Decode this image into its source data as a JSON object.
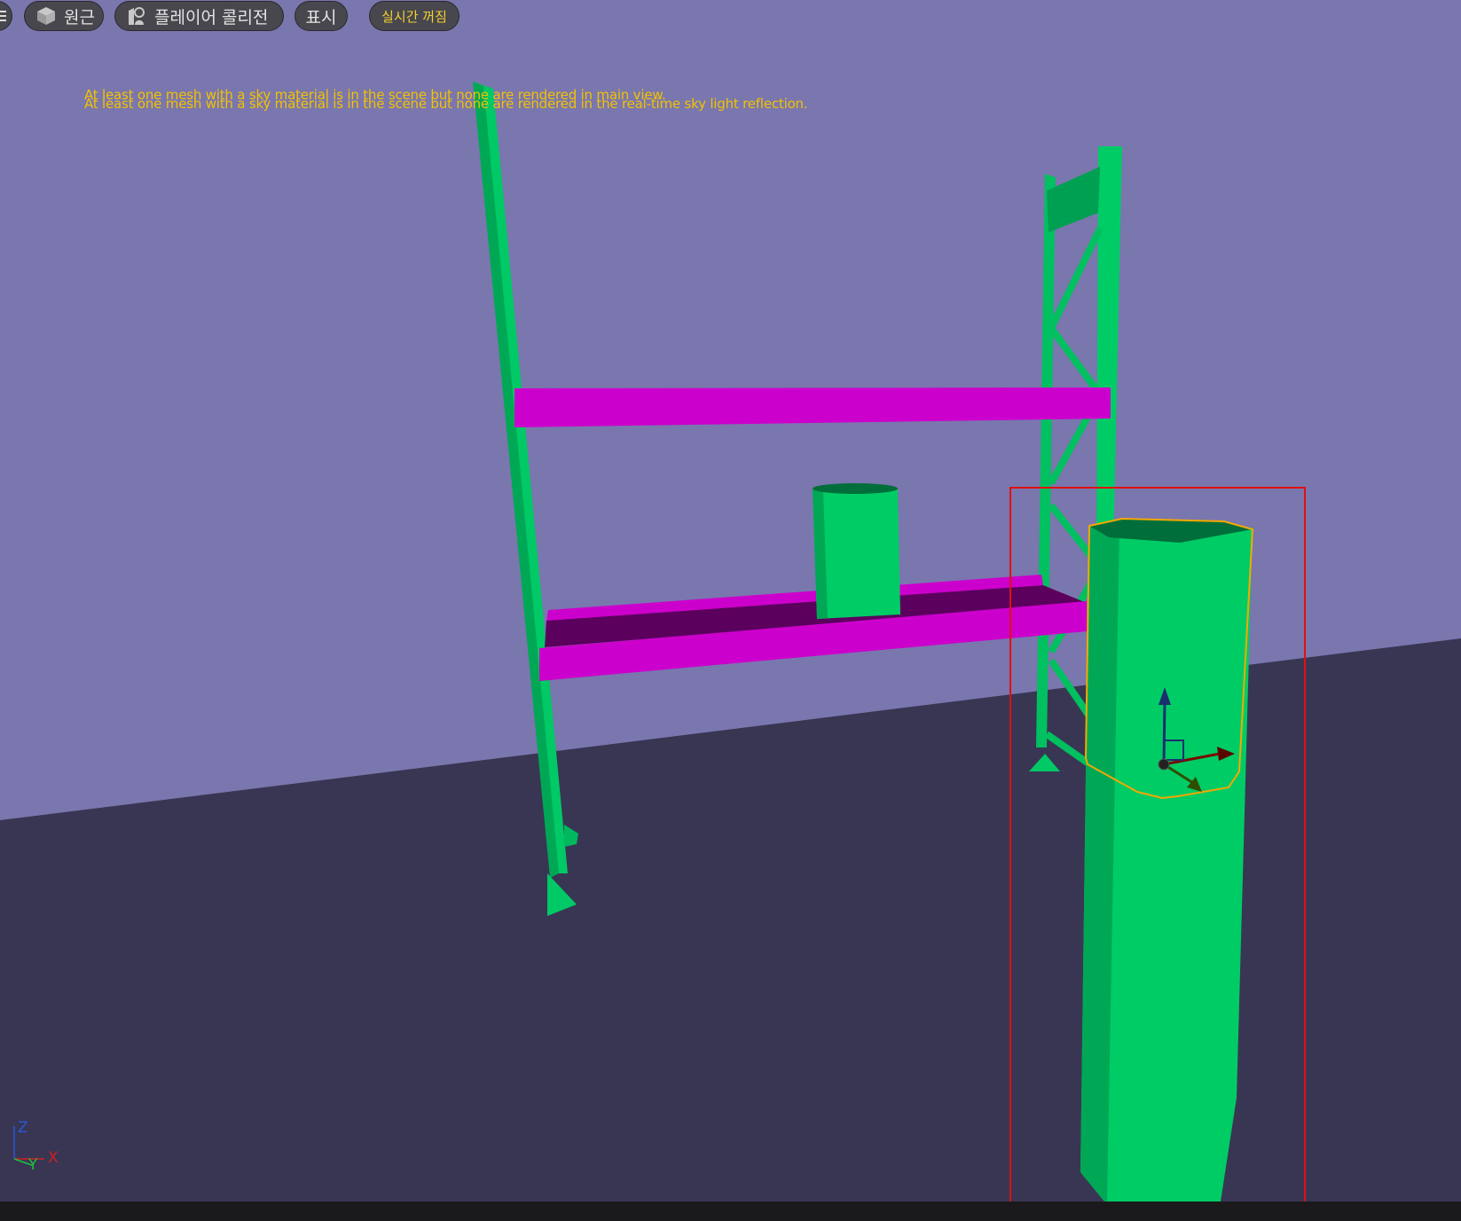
{
  "toolbar": {
    "menu_icon": "hamburger-icon",
    "perspective": {
      "label": "원근",
      "icon": "cube-icon"
    },
    "player_collision": {
      "label": "플레이어 콜리전",
      "icon": "collision-icon"
    },
    "show": {
      "label": "표시"
    },
    "realtime": {
      "label": "실시간 꺼짐"
    }
  },
  "warnings": [
    "At least one mesh with a sky material is in the scene but none are rendered in main view.",
    "At least one mesh with a sky material is in the scene but none are rendered in the real-time sky light reflection."
  ],
  "axis_legend": {
    "z": "Z",
    "y": "Y",
    "x": "X"
  },
  "colors": {
    "sky": "#7a76ae",
    "ground": "#383653",
    "mesh_green": "#00cc66",
    "mesh_magenta": "#cc00cc",
    "selection_outline": "#f5a800",
    "selection_box": "#e01010",
    "warning_text": "#f2c200"
  }
}
